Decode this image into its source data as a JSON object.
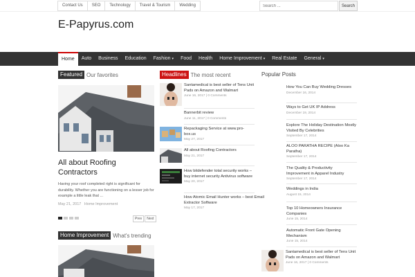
{
  "topbar": {
    "links": [
      "Contact Us",
      "SEO",
      "Technology",
      "Travel & Tourism",
      "Wedding"
    ],
    "search_placeholder": "Search ...",
    "search_button": "Search"
  },
  "site": {
    "title": "E-Papyrus.com"
  },
  "nav": {
    "items": [
      {
        "label": "Home",
        "active": true
      },
      {
        "label": "Auto"
      },
      {
        "label": "Business"
      },
      {
        "label": "Education"
      },
      {
        "label": "Fashion",
        "caret": "▾"
      },
      {
        "label": "Food"
      },
      {
        "label": "Health"
      },
      {
        "label": "Home Improvement",
        "caret": "▾"
      },
      {
        "label": "Real Estate"
      },
      {
        "label": "General",
        "caret": "▾"
      }
    ]
  },
  "featured": {
    "tag": "Featured",
    "subtitle": "Our favorites",
    "post_title": "All about Roofing Contractors",
    "excerpt": "Having your roof completed right is significant for durability. Whether you are functioning on a lesser job for example a little leak that ...",
    "meta": "May 21, 2017   Home Improvement",
    "pager_prev": "Prev",
    "pager_next": "Next"
  },
  "headlines": {
    "tag": "Headlines",
    "subtitle": "The most recent",
    "items": [
      {
        "title": "Santamedical is best seller of Tens Unit Pads on Amazon and Walmart",
        "meta": "June 16, 2017 | 0 Comments",
        "thumb": "back-icon"
      },
      {
        "title": "Bannerbit review",
        "meta": "June 11, 2017 | 0 Comments",
        "thumb": "none"
      },
      {
        "title": "Repackaging Service at www.pro-box.us",
        "meta": "May 27, 2017",
        "thumb": "boxes-icon"
      },
      {
        "title": "All about Roofing Contractors",
        "meta": "May 21, 2017",
        "thumb": "roof-icon"
      },
      {
        "title": "How bitdefender total security works – buy internet security Antivirus software",
        "meta": "May 20, 2017",
        "thumb": "screen-icon"
      },
      {
        "title": "How Atomic Email Hunter works – best Email Extractor Software",
        "meta": "May 17, 2017",
        "thumb": "none"
      }
    ]
  },
  "home_improvement": {
    "tag": "Home Improvement",
    "subtitle": "What's trending"
  },
  "popular": {
    "heading": "Popular Posts",
    "items": [
      {
        "title": "How You Can Buy Wedding Dresses",
        "date": "December 16, 2014"
      },
      {
        "title": "Ways to Get UK IP Address",
        "date": "December 19, 2014"
      },
      {
        "title": "Explore The Holiday Destination Mostly Visited By Celebrities",
        "date": "September 17, 2014"
      },
      {
        "title": "ALOO PARATHA RECIPE (Aloo Ka Paratha)",
        "date": "September 17, 2014"
      },
      {
        "title": "The Quality & Productivity Improvement in Apparel Industry",
        "date": "September 17, 2014"
      },
      {
        "title": "Weddings in India",
        "date": "August 15, 2014"
      },
      {
        "title": "Top 10 Homeowners Insurance Companies",
        "date": "June 15, 2014"
      },
      {
        "title": "Automatic Front Gate Opening Mechanism",
        "date": "June 15, 2014"
      }
    ],
    "last": {
      "title": "Santamedical is best seller of Tens Unit Pads on Amazon and Walmart",
      "meta": "June 16, 2017 | 0 Comments"
    }
  },
  "colors": {
    "headline_tag": "#cc1111",
    "dark_tag": "#333333",
    "nav_bg": "#333333",
    "nav_active_border": "#cc0000"
  }
}
